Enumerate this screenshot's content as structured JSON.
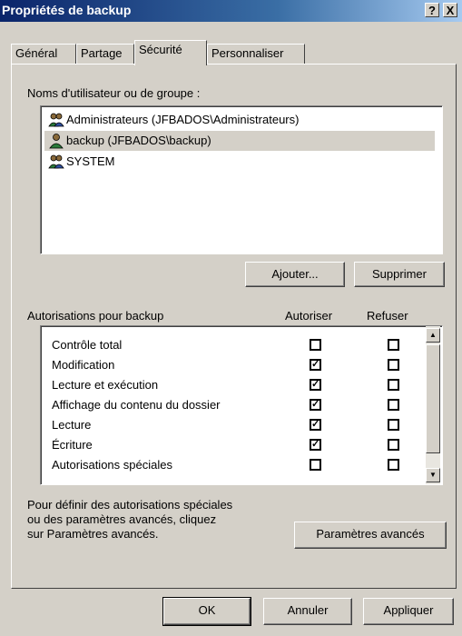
{
  "window": {
    "title": "Propriétés de backup",
    "help_label": "?",
    "close_label": "X"
  },
  "tabs": [
    {
      "label": "Général",
      "active": false
    },
    {
      "label": "Partage",
      "active": false
    },
    {
      "label": "Sécurité",
      "active": true
    },
    {
      "label": "Personnaliser",
      "active": false
    }
  ],
  "users": {
    "label": "Noms d'utilisateur ou de groupe :",
    "items": [
      {
        "label": "Administrateurs (JFBADOS\\Administrateurs)",
        "icon": "group-users-icon",
        "selected": false
      },
      {
        "label": "backup (JFBADOS\\backup)",
        "icon": "user-icon",
        "selected": true
      },
      {
        "label": "SYSTEM",
        "icon": "group-users-icon",
        "selected": false
      }
    ],
    "add_label": "Ajouter...",
    "remove_label": "Supprimer"
  },
  "permissions": {
    "label": "Autorisations pour backup",
    "allow_header": "Autoriser",
    "deny_header": "Refuser",
    "rows": [
      {
        "label": "Contrôle total",
        "allow": false,
        "deny": false
      },
      {
        "label": "Modification",
        "allow": true,
        "deny": false
      },
      {
        "label": "Lecture et exécution",
        "allow": true,
        "deny": false
      },
      {
        "label": "Affichage du contenu du dossier",
        "allow": true,
        "deny": false
      },
      {
        "label": "Lecture",
        "allow": true,
        "deny": false
      },
      {
        "label": "Écriture",
        "allow": true,
        "deny": false
      },
      {
        "label": "Autorisations spéciales",
        "allow": false,
        "deny": false
      }
    ]
  },
  "advanced": {
    "text_line1": "Pour définir des autorisations spéciales",
    "text_line2": "ou des paramètres avancés, cliquez",
    "text_line3": "sur Paramètres avancés.",
    "button_label": "Paramètres avancés"
  },
  "footer": {
    "ok_label": "OK",
    "cancel_label": "Annuler",
    "apply_label": "Appliquer"
  },
  "colors": {
    "title_bar_start": "#0a246a",
    "title_bar_end": "#a6caf0",
    "face": "#d4d0c8",
    "selection": "#d4d0c8"
  }
}
